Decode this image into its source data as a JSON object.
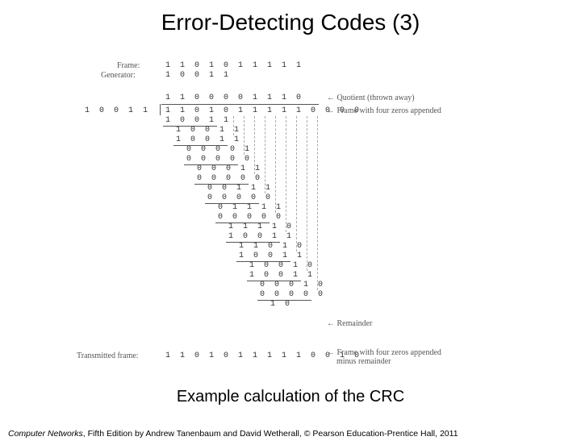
{
  "title": "Error-Detecting Codes (3)",
  "fig": {
    "frame_label": "Frame:",
    "generator_label": "Generator:",
    "frame_bits": "1 1 0 1 0 1 1 1 1 1",
    "generator_bits": "1 0 0 1 1",
    "divisor_left": "1 0 0 1 1",
    "quotient_bits": "1 1 0 0 0 0 1 1 1 0",
    "dividend_bits": "1 1 0 1 0 1 1 1 1 1 0 0 0 0",
    "quotient_note": "Quotient (thrown away)",
    "dividend_note": "Frame with four zeros appended",
    "remainder_note": "Remainder",
    "tx_label": "Transmitted frame:",
    "tx_bits": "1 1 0 1 0 1 1 1 1 1 0 0 1 0",
    "tx_note_a": "Frame with four zeros appended",
    "tx_note_b": "minus remainder",
    "steps": [
      "1 0 0 1 1",
      "1 0 0 1 1",
      "1 0 0 1 1",
      "0 0 0 0 1",
      "0 0 0 0 0",
      "0 0 0 1 1",
      "0 0 0 0 0",
      "0 0 1 1 1",
      "0 0 0 0 0",
      "0 1 1 1 1",
      "0 0 0 0 0",
      "1 1 1 1 0",
      "1 0 0 1 1",
      "1 1 0 1 0",
      "1 0 0 1 1",
      "1 0 0 1 0",
      "1 0 0 1 1",
      "0 0 0 1 0",
      "0 0 0 0 0",
      "1 0"
    ]
  },
  "caption": "Example calculation of the CRC",
  "footer_book": "Computer Networks",
  "footer_rest": ", Fifth Edition by Andrew Tanenbaum and David Wetherall, © Pearson Education-Prentice Hall, 2011"
}
